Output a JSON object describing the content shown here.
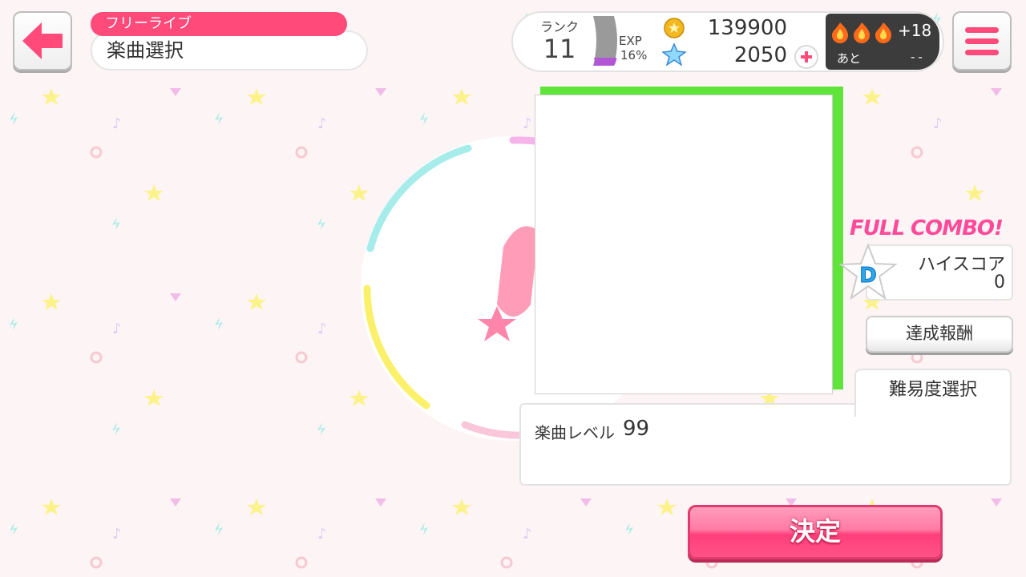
{
  "header": {
    "mode_tag": "フリーライブ",
    "screen_title": "楽曲選択"
  },
  "status": {
    "rank_label": "ランク",
    "rank_value": "11",
    "exp_label": "EXP",
    "exp_percent": "16%",
    "exp_progress": 0.16,
    "coins": "139900",
    "stars": "2050",
    "stamina_count": "+18",
    "stamina_label": "あと",
    "stamina_time": "--"
  },
  "song": {
    "full_combo": "FULL COMBO!",
    "score_rank": "D",
    "highscore_label": "ハイスコア",
    "highscore_value": "0",
    "reward_button": "達成報酬",
    "difficulty_tab": "難易度選択",
    "level_label": "楽曲レベル",
    "level_value": "99",
    "decide_button": "決定"
  },
  "icons": {
    "back": "back-arrow-icon",
    "menu": "hamburger-menu-icon",
    "coin": "coin-icon",
    "star": "star-gem-icon",
    "plus": "plus-icon",
    "fire": "fire-icon"
  },
  "colors": {
    "accent": "#ff4a7a",
    "jacket_border": "#5fe43a",
    "stamina_bg": "#3c3c3c"
  }
}
